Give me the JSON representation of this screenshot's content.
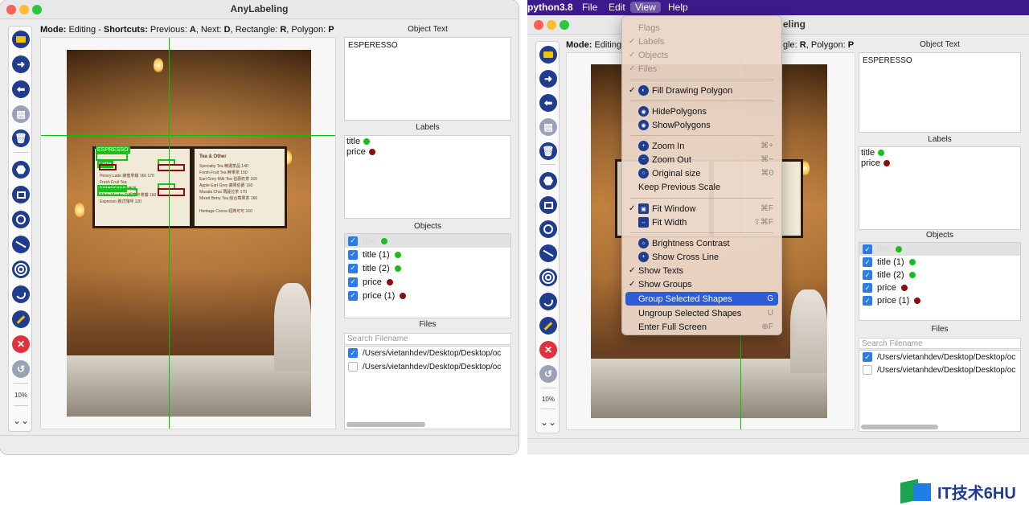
{
  "window1": {
    "title": "AnyLabeling",
    "zoom": "10%",
    "mode": {
      "mode_label": "Mode:",
      "mode_value": " Editing - ",
      "shortcuts_label": "Shortcuts:",
      "prev": " Previous: ",
      "prev_key": "A",
      "next": ", Next: ",
      "next_key": "D",
      "rect": ", Rectangle: ",
      "rect_key": "R",
      "poly": ", Polygon: ",
      "poly_key": "P"
    },
    "object_text": {
      "title": "Object Text",
      "value": "ESPERESSO"
    },
    "labels": {
      "title": "Labels",
      "items": [
        {
          "name": "title",
          "color": "#1bbf1b"
        },
        {
          "name": "price",
          "color": "#8a0e0e"
        }
      ]
    },
    "objects": {
      "title": "Objects",
      "items": [
        {
          "name": "title",
          "color": "#1bbf1b",
          "checked": true,
          "selected": true
        },
        {
          "name": "title (1)",
          "color": "#1bbf1b",
          "checked": true,
          "selected": false
        },
        {
          "name": "title (2)",
          "color": "#1bbf1b",
          "checked": true,
          "selected": false
        },
        {
          "name": "price",
          "color": "#8a0e0e",
          "checked": true,
          "selected": false
        },
        {
          "name": "price (1)",
          "color": "#8a0e0e",
          "checked": true,
          "selected": false
        }
      ]
    },
    "files": {
      "title": "Files",
      "search_placeholder": "Search Filename",
      "items": [
        {
          "path": "/Users/vietanhdev/Desktop/Desktop/oc",
          "checked": true
        },
        {
          "path": "/Users/vietanhdev/Desktop/Desktop/oc",
          "checked": false
        }
      ]
    },
    "canvas": {
      "tags": {
        "espresso": "ESPRESSO",
        "latte": "Latte",
        "americano": "Americano"
      },
      "menu_left": [
        "Honey Latte 蜂蜜拿鐵   160 170",
        "Fresh Fruit Tea",
        "Americano 卡布奇諾",
        "White Mocha 白朗摩卡拿鐵   160",
        "Espresso 義式咖啡   120"
      ],
      "menu_right_title": "Tea & Other",
      "menu_right": [
        "Specialty Tea 精選茶品   140",
        "Fresh Fruit Tea 鮮果茶   150",
        "Earl Grey Milk Tea 伯爵奶茶   160",
        "Apple Earl Grey 蘋果伯爵   160",
        "Masala Chai 瑪薩拉茶   170",
        "Mixed Berry Tea 綜合莓果茶   160",
        "Heritage Cocoa 經典可可   160"
      ],
      "prices": [
        "140",
        "160",
        "120",
        "120"
      ]
    }
  },
  "menubar": {
    "app": "python3.8",
    "file": "File",
    "edit": "Edit",
    "view": "View",
    "help": "Help"
  },
  "window2": {
    "title_fragment": "eling",
    "zoom": "10%",
    "mode": {
      "mode_label": "Mode:",
      "mode_value": " Editing",
      "tail": "gle: ",
      "rect_key": "R",
      "poly": ", Polygon: ",
      "poly_key": "P"
    },
    "object_text": {
      "title": "Object Text",
      "value": "ESPERESSO"
    },
    "labels": {
      "title": "Labels",
      "items": [
        {
          "name": "title",
          "color": "#1bbf1b"
        },
        {
          "name": "price",
          "color": "#8a0e0e"
        }
      ]
    },
    "objects": {
      "title": "Objects",
      "items": [
        {
          "name": "title",
          "color": "#1bbf1b",
          "checked": true,
          "selected": true
        },
        {
          "name": "title (1)",
          "color": "#1bbf1b",
          "checked": true,
          "selected": false
        },
        {
          "name": "title (2)",
          "color": "#1bbf1b",
          "checked": true,
          "selected": false
        },
        {
          "name": "price",
          "color": "#8a0e0e",
          "checked": true,
          "selected": false
        },
        {
          "name": "price (1)",
          "color": "#8a0e0e",
          "checked": true,
          "selected": false
        }
      ]
    },
    "files": {
      "title": "Files",
      "search_placeholder": "Search Filename",
      "items": [
        {
          "path": "/Users/vietanhdev/Desktop/Desktop/oc",
          "checked": true
        },
        {
          "path": "/Users/vietanhdev/Desktop/Desktop/oc",
          "checked": false
        }
      ]
    }
  },
  "view_menu": {
    "items": [
      {
        "label": "Flags",
        "check": "",
        "icon": "",
        "shortcut": "",
        "disabled": true
      },
      {
        "label": "Labels",
        "check": "✓",
        "icon": "",
        "shortcut": "",
        "disabled": true
      },
      {
        "label": "Objects",
        "check": "✓",
        "icon": "",
        "shortcut": "",
        "disabled": true
      },
      {
        "label": "Files",
        "check": "✓",
        "icon": "",
        "shortcut": "",
        "disabled": true
      },
      {
        "label": "Fill Drawing Polygon",
        "check": "✓",
        "icon": "fill-icon",
        "shortcut": ""
      },
      {
        "label": "HidePolygons",
        "check": "",
        "icon": "eye-icon",
        "shortcut": ""
      },
      {
        "label": "ShowPolygons",
        "check": "",
        "icon": "eye-icon",
        "shortcut": ""
      },
      {
        "label": "Zoom In",
        "check": "",
        "icon": "zoom-in-icon",
        "shortcut": "⌘+"
      },
      {
        "label": "Zoom Out",
        "check": "",
        "icon": "zoom-out-icon",
        "shortcut": "⌘−"
      },
      {
        "label": "Original size",
        "check": "",
        "icon": "zoom-icon",
        "shortcut": "⌘0"
      },
      {
        "label": "Keep Previous Scale",
        "check": "",
        "icon": "",
        "shortcut": ""
      },
      {
        "label": "Fit Window",
        "check": "✓",
        "icon": "fit-window-icon",
        "shortcut": "⌘F"
      },
      {
        "label": "Fit Width",
        "check": "",
        "icon": "fit-width-icon",
        "shortcut": "⇧⌘F"
      },
      {
        "label": "Brightness Contrast",
        "check": "",
        "icon": "brightness-icon",
        "shortcut": ""
      },
      {
        "label": "Show Cross Line",
        "check": "",
        "icon": "crossline-icon",
        "shortcut": ""
      },
      {
        "label": "Show Texts",
        "check": "✓",
        "icon": "",
        "shortcut": ""
      },
      {
        "label": "Show Groups",
        "check": "✓",
        "icon": "",
        "shortcut": ""
      },
      {
        "label": "Group Selected Shapes",
        "check": "",
        "icon": "",
        "shortcut": "G",
        "highlighted": true
      },
      {
        "label": "Ungroup Selected Shapes",
        "check": "",
        "icon": "",
        "shortcut": "U"
      },
      {
        "label": "Enter Full Screen",
        "check": "",
        "icon": "",
        "shortcut": "⊕F"
      }
    ]
  },
  "watermark": {
    "text": "IT技术6HU"
  },
  "colors": {
    "accent": "#2a7ce8",
    "menubar": "#3d1a8a",
    "highlight": "#2e5bd6",
    "title_label": "#1bbf1b",
    "price_label": "#8a0e0e"
  }
}
